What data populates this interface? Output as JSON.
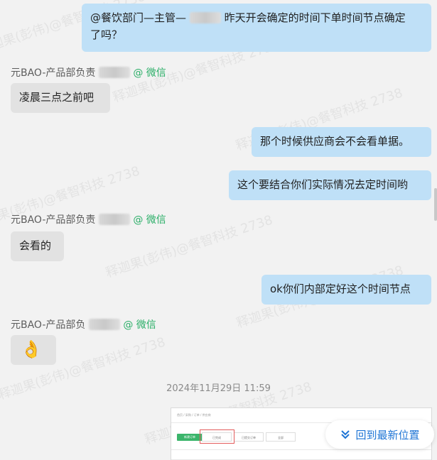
{
  "messages": [
    {
      "type": "out",
      "text_lines": [
        "@餐饮部门—主管—",
        "了吗？"
      ],
      "text_tail": "昨天开会确定的时间下单时间节点确定"
    },
    {
      "type": "sender",
      "prefix": "元BAO-产品部负责",
      "tag": "@ 微信"
    },
    {
      "type": "in",
      "text": "凌晨三点之前吧"
    },
    {
      "type": "out",
      "text": "那个时候供应商会不会看单据。"
    },
    {
      "type": "out",
      "text": "这个要结合你们实际情况去定时间哟"
    },
    {
      "type": "sender",
      "prefix": "元BAO-产品部负责",
      "tag": "@ 微信"
    },
    {
      "type": "in",
      "text": "会看的"
    },
    {
      "type": "out",
      "text": "ok你们内部定好这个时间节点"
    },
    {
      "type": "sender",
      "prefix": "元BAO-产品部负",
      "tag": "@ 微信"
    },
    {
      "type": "in",
      "emoji": "👌"
    }
  ],
  "timestamp": "2024年11月29日 11:59",
  "watermark_text": "释迦果(彭伟)@餐智科技 2738",
  "back_to_latest_label": "回到最新位置",
  "thumbnail": {
    "breadcrumb": "首页 / 采购 / 订单 / 供应商",
    "tabs": [
      "已完成",
      "已提交订单",
      "全部"
    ],
    "button": "新建订单"
  },
  "colors": {
    "outgoing_bubble": "#bfe0f7",
    "incoming_bubble": "#e2e2e2",
    "wechat_tag": "#2aae67",
    "accent_blue": "#1d74d5"
  }
}
